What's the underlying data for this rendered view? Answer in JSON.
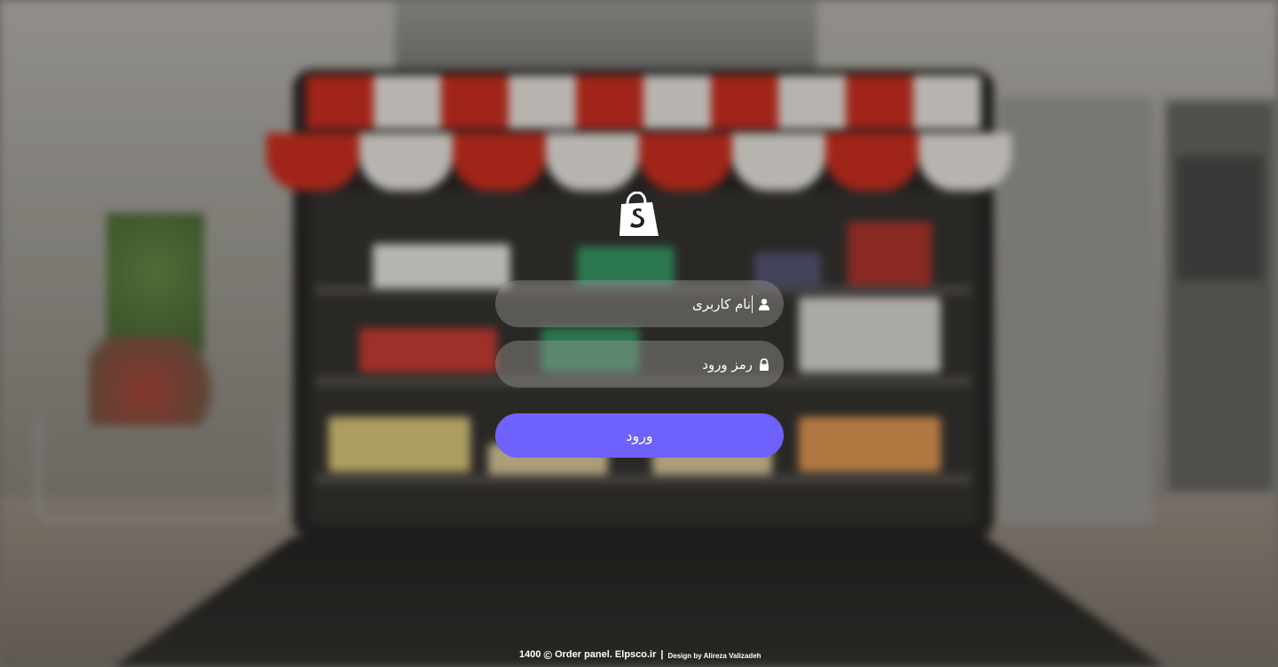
{
  "login": {
    "username_placeholder": "نام کاربری",
    "password_placeholder": "رمز ورود",
    "submit_label": "ورود",
    "accent_color": "#6f61fb",
    "icons": [
      "shopify-logo-icon",
      "user-icon",
      "lock-icon"
    ]
  },
  "footer": {
    "year": "1400",
    "copyright_symbol": "©",
    "site": "Order panel. Elpsco.ir",
    "separator": "|",
    "credit": "Design by Alireza Valizadeh"
  }
}
